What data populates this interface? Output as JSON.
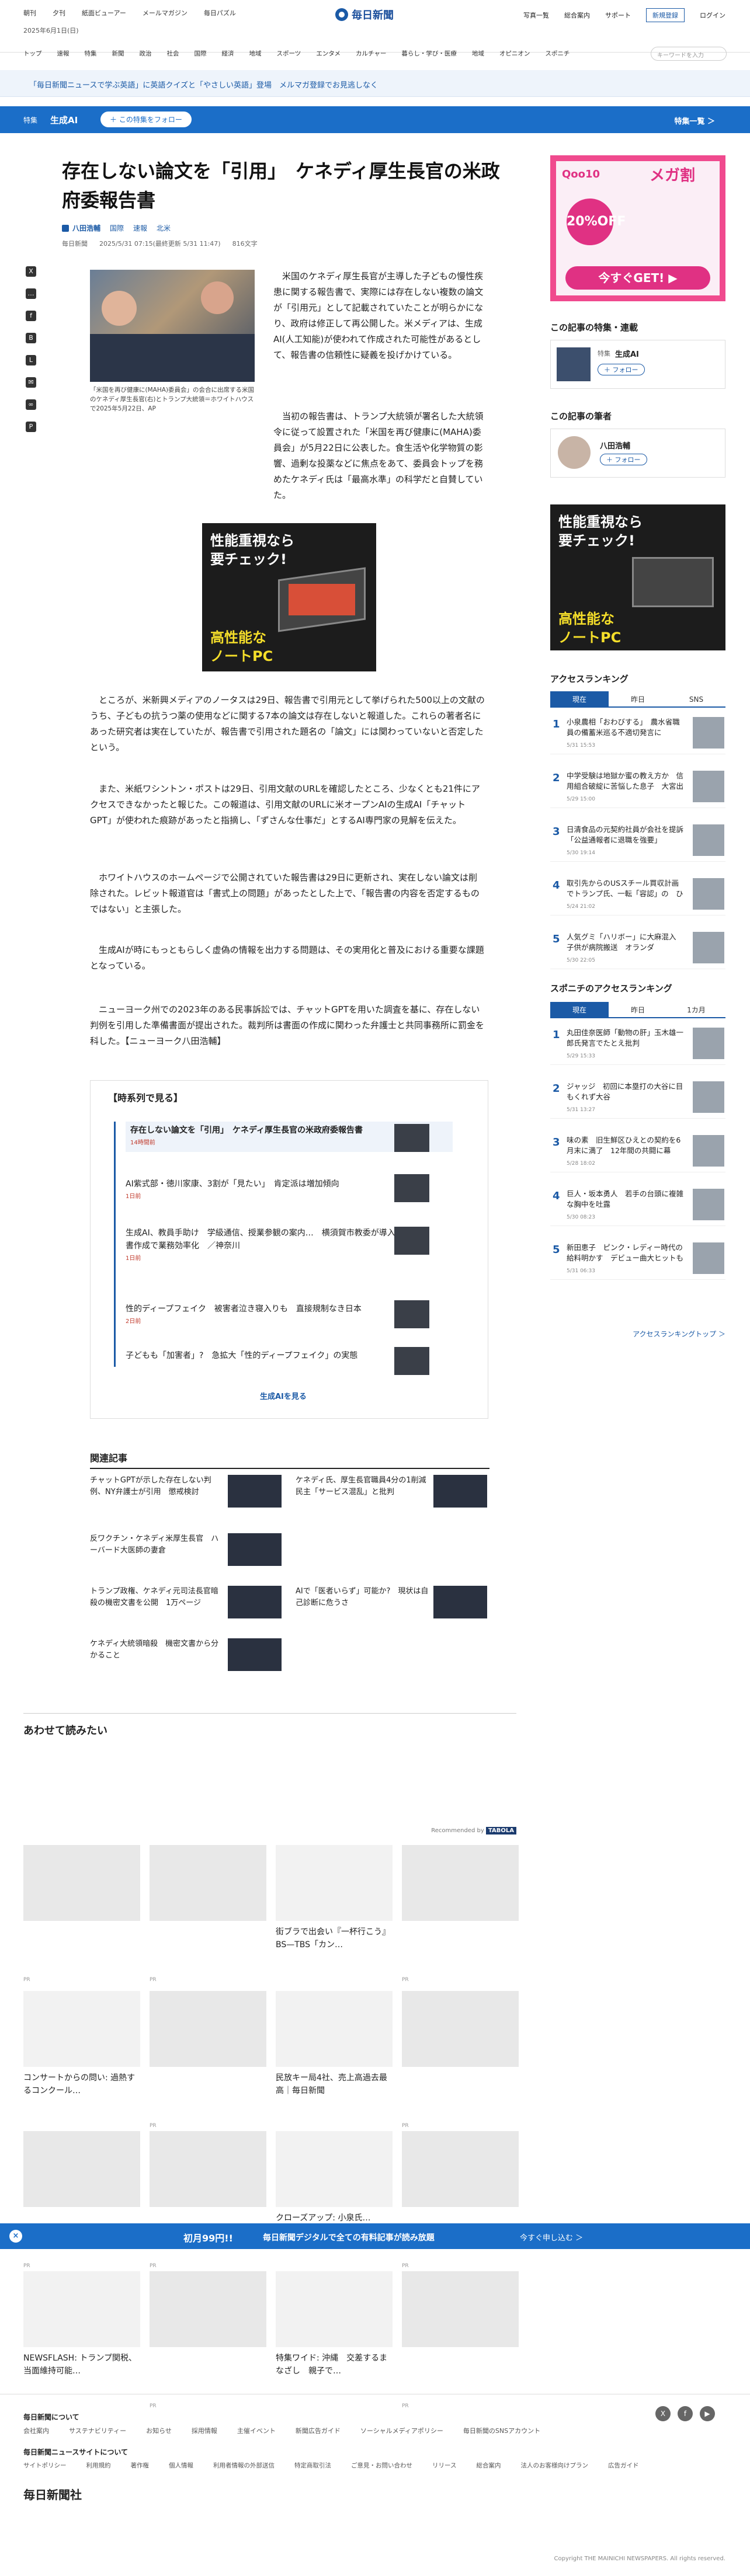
{
  "header": {
    "utility_links": [
      "朝刊",
      "夕刊",
      "紙面ビューアー",
      "メールマガジン",
      "毎日パズル"
    ],
    "date": "2025年6月1日(日)",
    "logo_text": "毎日新聞",
    "right_links": [
      "写真一覧",
      "総合案内",
      "サポート"
    ],
    "register": "新規登録",
    "login": "ログイン",
    "nav": [
      "トップ",
      "速報",
      "特集",
      "新聞",
      "政治",
      "社会",
      "国際",
      "経済",
      "地域",
      "スポーツ",
      "エンタメ",
      "カルチャー",
      "暮らし・学び・医療",
      "地域",
      "オピニオン",
      "スポニチ"
    ],
    "search_placeholder": "キーワードを入力"
  },
  "promo": {
    "text": "「毎日新聞ニュースで学ぶ英語」に英語クイズと「やさしい英語」登場　メルマガ登録でお見逃しなく"
  },
  "feature_bar": {
    "label": "特集",
    "name": "生成AI",
    "follow": "＋ この特集をフォロー",
    "more": "特集一覧 ＞"
  },
  "article": {
    "headline": "存在しない論文を「引用」　ケネディ厚生長官の米政府委報告書",
    "author": "八田浩輔",
    "tags": [
      "国際",
      "速報",
      "北米"
    ],
    "source": "毎日新聞",
    "timestamp": "2025/5/31 07:15(最終更新 5/31 11:47)",
    "chars": "816文字",
    "photo_caption": "「米国を再び健康に(MAHA)委員会」の会合に出席する米国のケネディ厚生長官(右)とトランプ大統領＝ホワイトハウスで2025年5月22日、AP",
    "paragraphs": [
      "米国のケネディ厚生長官が主導した子どもの慢性疾患に関する報告書で、実際には存在しない複数の論文が「引用元」として記載されていたことが明らかになり、政府は修正して再公開した。米メディアは、生成AI(人工知能)が使われて作成された可能性があるとして、報告書の信頼性に疑義を投げかけている。",
      "当初の報告書は、トランプ大統領が署名した大統領令に従って設置された「米国を再び健康に(MAHA)委員会」が5月22日に公表した。食生活や化学物質の影響、過剰な投薬などに焦点をあて、委員会トップを務めたケネディ氏は「最高水準」の科学だと自賛していた。",
      "ところが、米新興メディアのノータスは29日、報告書で引用元として挙げられた500以上の文献のうち、子どもの抗うつ薬の使用などに関する7本の論文は存在しないと報道した。これらの著者名にあった研究者は実在していたが、報告書で引用された題名の「論文」には関わっていないと否定したという。",
      "また、米紙ワシントン・ポストは29日、引用文献のURLを確認したところ、少なくとも21件にアクセスできなかったと報じた。この報道は、引用文献のURLに米オープンAIの生成AI「チャットGPT」が使われた痕跡があったと指摘し、「ずさんな仕事だ」とするAI専門家の見解を伝えた。",
      "ホワイトハウスのホームページで公開されていた報告書は29日に更新され、実在しない論文は削除された。レビット報道官は「書式上の問題」があったとした上で、「報告書の内容を否定するものではない」と主張した。",
      "生成AIが時にもっともらしく虚偽の情報を出力する問題は、その実用化と普及における重要な課題となっている。",
      "ニューヨーク州での2023年のある民事訴訟では、チャットGPTを用いた調査を基に、存在しない判例を引用した準備書面が提出された。裁判所は書面の作成に関わった弁護士と共同事務所に罰金を科した。【ニューヨーク八田浩輔】"
    ]
  },
  "inline_ad": {
    "line1": "性能重視なら",
    "line2": "要チェック!",
    "line3": "高性能な",
    "line4": "ノートPC"
  },
  "timeline": {
    "title": "【時系列で見る】",
    "items": [
      {
        "title": "存在しない論文を「引用」　ケネディ厚生長官の米政府委報告書",
        "date": "14時間前"
      },
      {
        "title": "AI紫式部・徳川家康、3割が「見たい」　肯定派は増加傾向",
        "date": "1日前"
      },
      {
        "title": "生成AI、教員手助け　学級通信、授業参観の案内…　横須賀市教委が導入開始　文書作成で業務効率化　／神奈川",
        "date": "1日前"
      },
      {
        "title": "性的ディープフェイク　被害者泣き寝入りも　直接規制なき日本",
        "date": "2日前"
      },
      {
        "title": "子どもも「加害者」?　急拡大「性的ディープフェイク」の実態",
        "date": ""
      }
    ],
    "more": "生成AIを見る"
  },
  "related": {
    "title": "関連記事",
    "items": [
      "チャットGPTが示した存在しない判例、NY弁護士が引用　懲戒検討",
      "ケネディ氏、厚生長官職員4分の1削減　民主「サービス混乱」と批判",
      "反ワクチン・ケネディ米厚生長官　ハーバード大医師の妻倉",
      "トランプ政権、ケネディ元司法長官暗殺の機密文書を公開　1万ページ",
      "AIで「医者いらず」可能か?　現状は自己診断に危うさ",
      "ケネディ大統領暗殺　機密文書から分かること"
    ]
  },
  "read_too": {
    "title": "あわせて読みたい",
    "recommended": "Recommended by",
    "recommended_brand": "TABOLA",
    "items": [
      {
        "title": "",
        "pr": "PR"
      },
      {
        "title": "",
        "pr": "PR"
      },
      {
        "title": "街ブラで出会い『一杯行こう』　BS—TBS「カン…",
        "pr": ""
      },
      {
        "title": "",
        "pr": "PR"
      },
      {
        "title": "コンサートからの問い: 過熱するコンクール…",
        "pr": ""
      },
      {
        "title": "",
        "pr": "PR"
      },
      {
        "title": "民放キー局4社、売上高過去最高｜毎日新聞",
        "pr": ""
      },
      {
        "title": "",
        "pr": "PR"
      },
      {
        "title": "",
        "pr": "PR"
      },
      {
        "title": "",
        "pr": "PR"
      },
      {
        "title": "クローズアップ: 小泉氏…",
        "pr": ""
      },
      {
        "title": "",
        "pr": "PR"
      },
      {
        "title": "NEWSFLASH: トランプ関税、当面維持可能…",
        "pr": ""
      },
      {
        "title": "",
        "pr": "PR"
      },
      {
        "title": "特集ワイド: 沖縄　交差するまなざし　親子で…",
        "pr": ""
      },
      {
        "title": "",
        "pr": "PR"
      }
    ]
  },
  "sidebar": {
    "ad_brand": "Qoo10",
    "ad_mega": "メガ割",
    "ad_off": "20%OFF",
    "ad_get": "今すぐGET! ▶",
    "feature_heading": "この記事の特集・連載",
    "feature_label": "特集",
    "feature_name": "生成AI",
    "follow": "＋ フォロー",
    "author_heading": "この記事の筆者",
    "author_name": "八田浩輔",
    "ad2_line1": "性能重視なら",
    "ad2_line2": "要チェック!",
    "ad2_line3": "高性能な",
    "ad2_line4": "ノートPC",
    "ranking_heading": "アクセスランキング",
    "ranking_tabs": [
      "現在",
      "昨日",
      "SNS"
    ],
    "ranking": [
      {
        "rank": "1",
        "title": "小泉農相「おわびする」　農水省職員の備蓄米巡る不適切発言に",
        "date": "5/31 15:53"
      },
      {
        "rank": "2",
        "title": "中学受験は地獄か蜜の教え方か　信用組合破綻に苦悩した息子　大宮出",
        "date": "5/29 15:00"
      },
      {
        "rank": "3",
        "title": "日清食品の元契約社員が会社を提訴「公益通報者に退職を強要」",
        "date": "5/30 19:14"
      },
      {
        "rank": "4",
        "title": "取引先からのUSスチール買収計画でトランプ氏、一転「容認」の　ひ",
        "date": "5/24 21:02"
      },
      {
        "rank": "5",
        "title": "人気グミ「ハリボー」に大麻混入　子供が病院搬送　オランダ",
        "date": "5/30 22:05"
      }
    ],
    "sponichi_heading": "スポニチのアクセスランキング",
    "sponichi_tabs": [
      "現在",
      "昨日",
      "1カ月"
    ],
    "sponichi": [
      {
        "rank": "1",
        "title": "丸田佳奈医師「動物の肝」玉木雄一郎氏発言でたとえ批判",
        "date": "5/29 15:33"
      },
      {
        "rank": "2",
        "title": "ジャッジ　初回に本塁打の大谷に目もくれず大谷",
        "date": "5/31 13:27"
      },
      {
        "rank": "3",
        "title": "味の素　旧生鮮区ひえとの契約を6月末に満了　12年間の共闘に幕",
        "date": "5/28 18:02"
      },
      {
        "rank": "4",
        "title": "巨人・坂本勇人　若手の台頭に複雑な胸中を吐露",
        "date": "5/30 08:23"
      },
      {
        "rank": "5",
        "title": "新田恵子　ピンク・レディー時代の給料明かす　デビュー曲大ヒットも",
        "date": "5/31 06:33"
      }
    ],
    "ranking_more": "アクセスランキングトップ ＞"
  },
  "sticky": {
    "offer": "初月99円!!",
    "message": "毎日新聞デジタルで全ての有料記事が読み放題",
    "cta": "今すぐ申し込む ＞"
  },
  "footer": {
    "about_heading": "毎日新聞について",
    "about_links": [
      "会社案内",
      "サステナビリティー",
      "お知らせ",
      "採用情報",
      "主催イベント",
      "新聞広告ガイド",
      "ソーシャルメディアポリシー",
      "毎日新聞のSNSアカウント"
    ],
    "site_heading": "毎日新聞ニュースサイトについて",
    "site_links": [
      "サイトポリシー",
      "利用規約",
      "著作権",
      "個人情報",
      "利用者情報の外部送信",
      "特定商取引法",
      "ご意見・お問い合わせ",
      "リリース",
      "総合案内",
      "法人のお客様向けプラン",
      "広告ガイド"
    ],
    "logo": "毎日新聞社",
    "copyright": "Copyright THE MAINICHI NEWSPAPERS. All rights reserved."
  }
}
